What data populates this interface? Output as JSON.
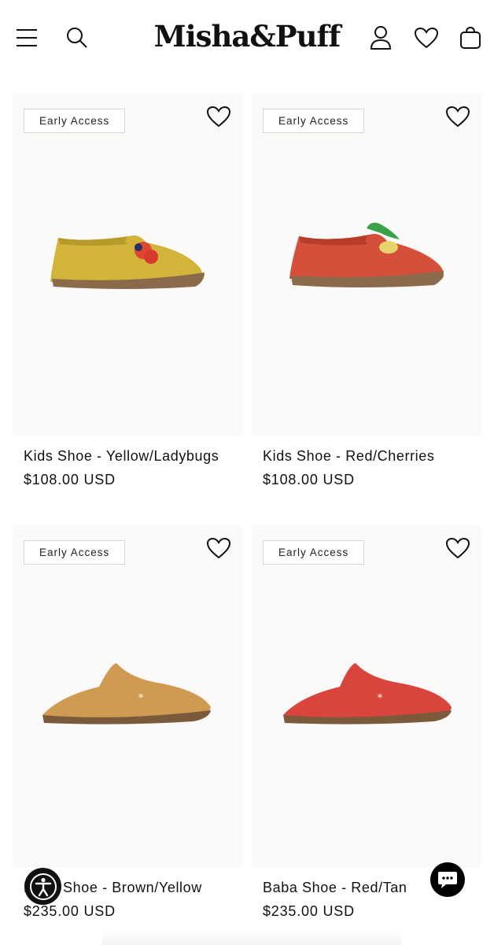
{
  "header": {
    "logo_text": "Misha&Puff",
    "icons": [
      "menu-icon",
      "search-icon",
      "account-icon",
      "wishlist-icon",
      "cart-icon"
    ]
  },
  "products": [
    {
      "badge": "Early Access",
      "title": "Kids Shoe - Yellow/Ladybugs",
      "price": "$108.00 USD",
      "colors": {
        "body": "#d2b43a",
        "sole": "#8a6a4a",
        "accent": "#e0452e"
      }
    },
    {
      "badge": "Early Access",
      "title": "Kids Shoe - Red/Cherries",
      "price": "$108.00 USD",
      "colors": {
        "body": "#d5503a",
        "sole": "#8a6a4a",
        "accent": "#3aa14a"
      }
    },
    {
      "badge": "Early Access",
      "title": "Baba Shoe - Brown/Yellow",
      "price": "$235.00 USD",
      "colors": {
        "body": "#cf9a52",
        "sole": "#7a5a3a",
        "accent": "#f1e3c4"
      }
    },
    {
      "badge": "Early Access",
      "title": "Baba Shoe - Red/Tan",
      "price": "$235.00 USD",
      "colors": {
        "body": "#d9453c",
        "sole": "#7a5a3a",
        "accent": "#f1d2b4"
      }
    }
  ],
  "floating": {
    "accessibility_icon": "accessibility-icon",
    "chat_icon": "chat-icon"
  },
  "colors": {
    "background": "#ffffff",
    "card_background": "#fbfaf8",
    "text": "#121212"
  }
}
